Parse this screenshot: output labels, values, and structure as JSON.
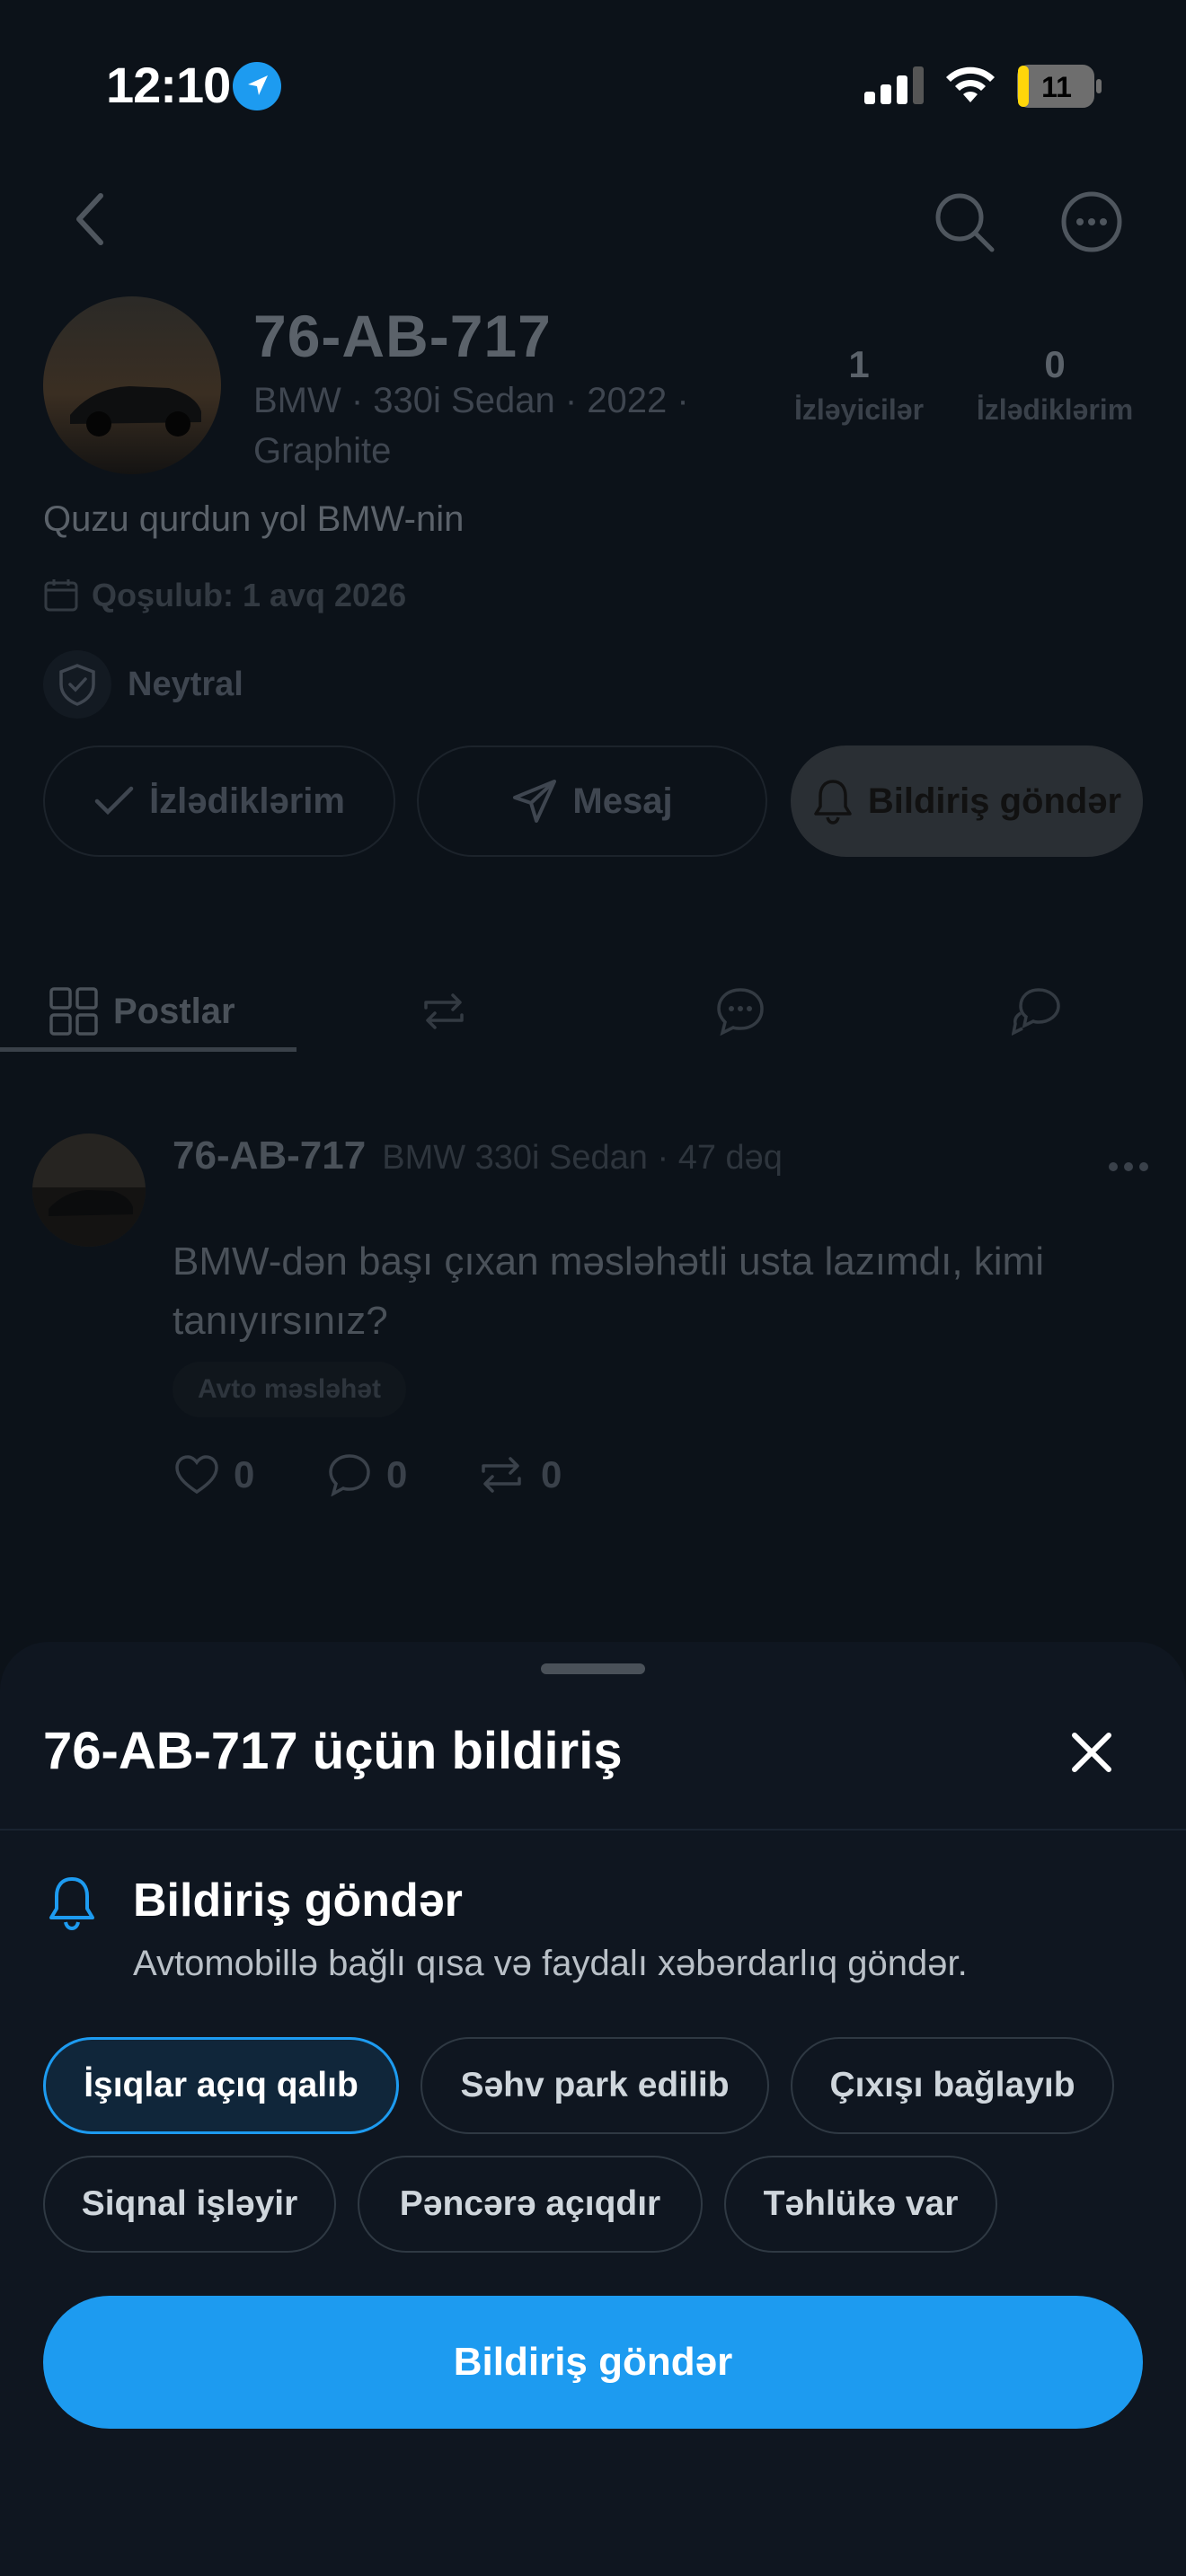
{
  "status_bar": {
    "time": "12:10",
    "battery": "11"
  },
  "profile": {
    "plate": "76-AB-717",
    "car_info": "BMW · 330i Sedan · 2022 · Graphite",
    "followers_count": "1",
    "followers_label": "İzləyicilər",
    "following_count": "0",
    "following_label": "İzlədiklərim",
    "bio": "Quzu qurdun yol BMW-nin",
    "joined": "Qoşulub: 1 avq 2026",
    "reputation": "Neytral",
    "buttons": {
      "follow": "İzlədiklərim",
      "message": "Mesaj",
      "notify": "Bildiriş göndər"
    }
  },
  "tabs": [
    {
      "label": "Postlar"
    }
  ],
  "post": {
    "author": "76-AB-717",
    "meta": "BMW 330i Sedan · 47 dəq",
    "body": "BMW-dən başı çıxan məsləhətli usta lazımdı, kimi tanıyırsınız?",
    "tag": "Avto məsləhət",
    "likes": "0",
    "comments": "0",
    "reposts": "0"
  },
  "sheet": {
    "title": "76-AB-717 üçün bildiriş",
    "section_title": "Bildiriş göndər",
    "section_desc": "Avtomobillə bağlı qısa və faydalı xəbərdarlıq göndər.",
    "options": [
      {
        "label": "İşıqlar açıq qalıb",
        "selected": true
      },
      {
        "label": "Səhv park edilib",
        "selected": false
      },
      {
        "label": "Çıxışı bağlayıb",
        "selected": false
      },
      {
        "label": "Siqnal işləyir",
        "selected": false
      },
      {
        "label": "Pəncərə açıqdır",
        "selected": false
      },
      {
        "label": "Təhlükə var",
        "selected": false
      }
    ],
    "submit_label": "Bildiriş göndər"
  },
  "colors": {
    "accent": "#1d9bf0",
    "background": "#0c1219",
    "sheet": "#0f1620"
  }
}
